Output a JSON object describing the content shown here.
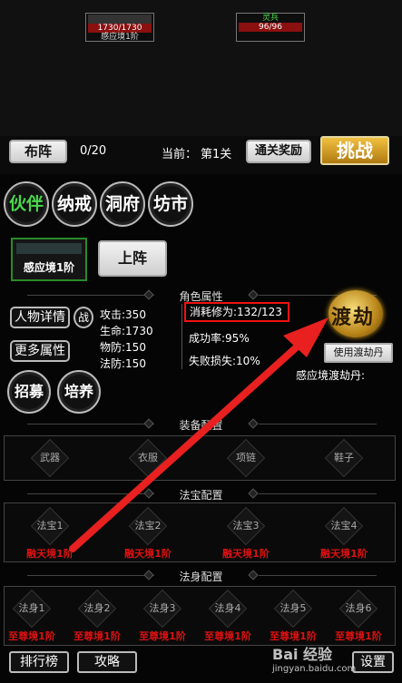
{
  "top": {
    "player": {
      "hp": "1730/1730",
      "realm": "感应境1阶"
    },
    "enemy": {
      "name": "灵兵",
      "hp": "96/96"
    }
  },
  "stage_bar": {
    "formation_label": "布阵",
    "count": "0/20",
    "current_label": "当前：",
    "current_level": "第1关",
    "reward_label": "通关奖励",
    "challenge_label": "挑战"
  },
  "tabs": [
    "伙伴",
    "纳戒",
    "洞府",
    "坊市"
  ],
  "partner": {
    "realm": "感应境1阶",
    "deploy_label": "上阵"
  },
  "attributes": {
    "title": "角色属性",
    "detail_label": "人物详情",
    "battle_label": "战",
    "more_label": "更多属性",
    "stats": [
      "攻击:350",
      "生命:1730",
      "物防:150",
      "法防:150"
    ],
    "consume": "消耗修为:132/123",
    "success": "成功率:95%",
    "fail": "失败损失:10%",
    "tribulation_label": "渡劫",
    "use_pill_label": "使用渡劫丹",
    "pill_text": "感应境渡劫丹:",
    "recruit_label": "招募",
    "train_label": "培养"
  },
  "equipment": {
    "title": "装备配置",
    "slots": [
      "武器",
      "衣服",
      "项链",
      "鞋子"
    ]
  },
  "treasure": {
    "title": "法宝配置",
    "slots": [
      "法宝1",
      "法宝2",
      "法宝3",
      "法宝4"
    ],
    "reqs": [
      "融天境1阶",
      "融天境1阶",
      "融天境1阶",
      "融天境1阶"
    ]
  },
  "body": {
    "title": "法身配置",
    "slots": [
      "法身1",
      "法身2",
      "法身3",
      "法身4",
      "法身5",
      "法身6"
    ],
    "reqs": [
      "至尊境1阶",
      "至尊境1阶",
      "至尊境1阶",
      "至尊境1阶",
      "至尊境1阶",
      "至尊境1阶"
    ]
  },
  "bottom": {
    "ranking_label": "排行榜",
    "guide_label": "攻略",
    "settings_label": "设置"
  },
  "watermark": {
    "brand": "Bai 经验",
    "url": "jingyan.baidu.com"
  },
  "colors": {
    "accent_green": "#49d84b",
    "warning_red": "#dd1111",
    "hp_red": "#8b1010",
    "gold": "#d9a420"
  }
}
